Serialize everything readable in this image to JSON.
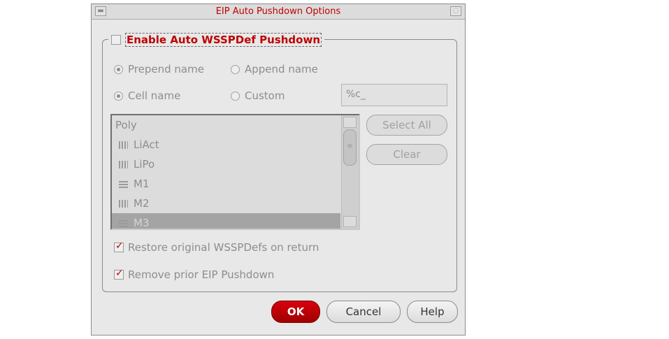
{
  "window": {
    "title": "EIP Auto Pushdown Options"
  },
  "enable": {
    "label": "Enable Auto WSSPDef Pushdown",
    "checked": false
  },
  "name_position": {
    "prepend_label": "Prepend name",
    "append_label": "Append name",
    "selected": "prepend"
  },
  "name_source": {
    "cell_label": "Cell name",
    "custom_label": "Custom",
    "selected": "cell",
    "custom_value": "%c_"
  },
  "layers": {
    "items": [
      {
        "label": "Poly",
        "icon": "none",
        "selected": false
      },
      {
        "label": "LiAct",
        "icon": "vertical-stripe-icon",
        "selected": false
      },
      {
        "label": "LiPo",
        "icon": "vertical-stripe-icon",
        "selected": false
      },
      {
        "label": "M1",
        "icon": "horizontal-stripe-icon",
        "selected": false
      },
      {
        "label": "M2",
        "icon": "vertical-stripe-icon",
        "selected": false
      },
      {
        "label": "M3",
        "icon": "horizontal-stripe-icon",
        "selected": true
      }
    ]
  },
  "side_buttons": {
    "select_all": "Select All",
    "clear": "Clear"
  },
  "options": {
    "restore_label": "Restore original WSSPDefs on return",
    "restore_checked": true,
    "remove_label": "Remove prior EIP Pushdown",
    "remove_checked": true
  },
  "buttons": {
    "ok": "OK",
    "cancel": "Cancel",
    "help": "Help"
  },
  "colors": {
    "accent": "#c00000",
    "disabled_text": "#8d8d8d"
  }
}
